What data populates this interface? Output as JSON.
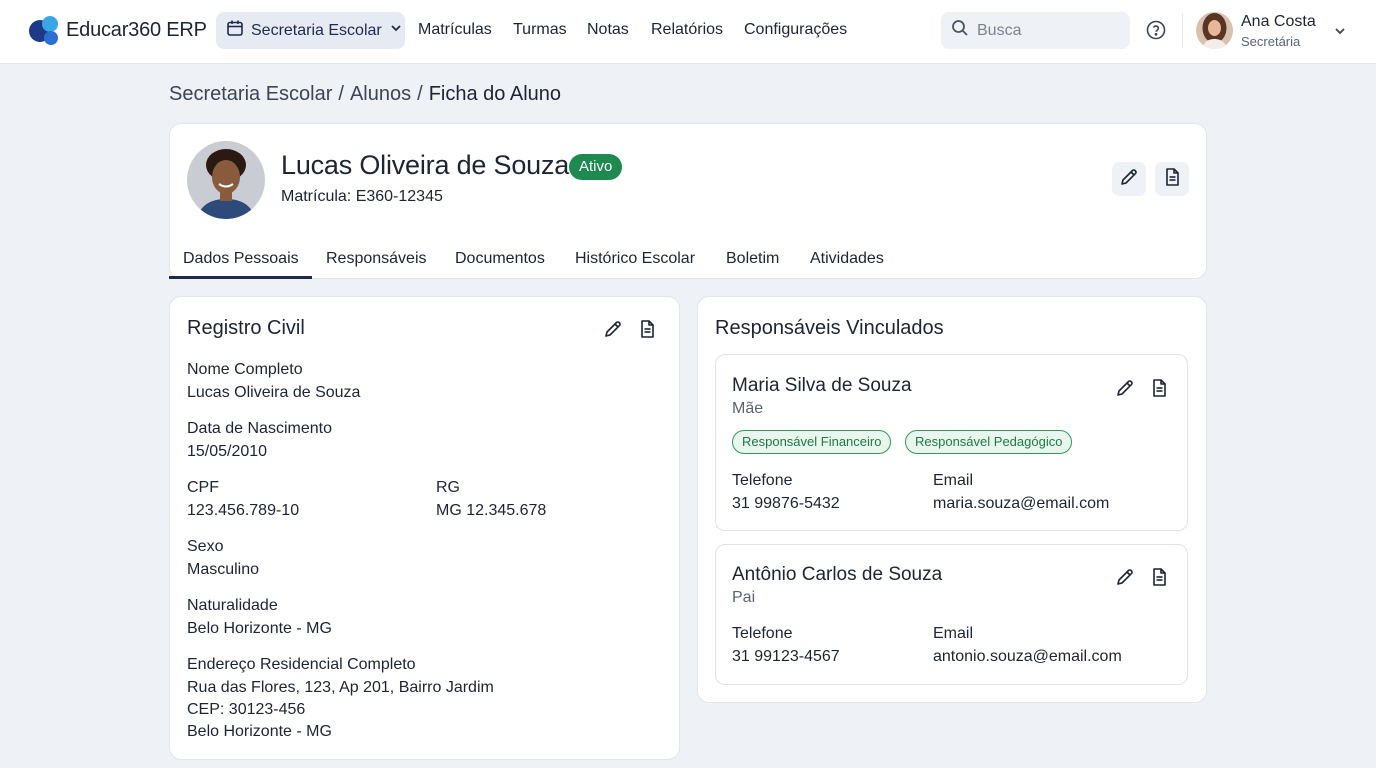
{
  "app": {
    "name": "Educar360 ERP"
  },
  "topbar": {
    "module_selector": "Secretaria Escolar",
    "nav": [
      "Matrículas",
      "Turmas",
      "Notas",
      "Relatórios",
      "Configurações"
    ],
    "search_placeholder": "Busca",
    "user": {
      "name": "Ana Costa",
      "role": "Secretária"
    }
  },
  "breadcrumb": {
    "items": [
      "Secretaria Escolar",
      "Alunos"
    ],
    "current": "Ficha do Aluno",
    "separator": "/"
  },
  "student": {
    "name": "Lucas Oliveira de Souza",
    "status": "Ativo",
    "matricula": "Matrícula: E360-12345"
  },
  "tabs": [
    "Dados Pessoais",
    "Responsáveis",
    "Documentos",
    "Histórico Escolar",
    "Boletim",
    "Atividades"
  ],
  "registro_civil": {
    "title": "Registro Civil",
    "nome_label": "Nome Completo",
    "nome_value": "Lucas Oliveira de Souza",
    "nascimento_label": "Data de Nascimento",
    "nascimento_value": "15/05/2010",
    "cpf_label": "CPF",
    "cpf_value": "123.456.789-10",
    "rg_label": "RG",
    "rg_value": "MG 12.345.678",
    "sexo_label": "Sexo",
    "sexo_value": "Masculino",
    "naturalidade_label": "Naturalidade",
    "naturalidade_value": "Belo Horizonte - MG",
    "endereco_label": "Endereço Residencial Completo",
    "endereco_line1": "Rua das Flores, 123, Ap 201, Bairro Jardim",
    "endereco_line2": "CEP: 30123-456",
    "endereco_line3": "Belo Horizonte - MG"
  },
  "responsaveis": {
    "title": "Responsáveis Vinculados",
    "items": [
      {
        "name": "Maria Silva de Souza",
        "relation": "Mãe",
        "tags": [
          "Responsável Financeiro",
          "Responsável Pedagógico"
        ],
        "phone_label": "Telefone",
        "phone": "31 99876-5432",
        "email_label": "Email",
        "email": "maria.souza@email.com"
      },
      {
        "name": "Antônio Carlos de Souza",
        "relation": "Pai",
        "phone_label": "Telefone",
        "phone": "31 99123-4567",
        "email_label": "Email",
        "email": "antonio.souza@email.com"
      }
    ]
  },
  "colors": {
    "accent": "#1d2a4d",
    "status_active": "#1e8a4f",
    "tag_border": "#2f9a5e",
    "page_bg": "#eef1f5"
  },
  "icons": [
    "logo-icon",
    "calendar-icon",
    "chevron-down-icon",
    "search-icon",
    "help-icon",
    "pencil-icon",
    "document-icon"
  ]
}
